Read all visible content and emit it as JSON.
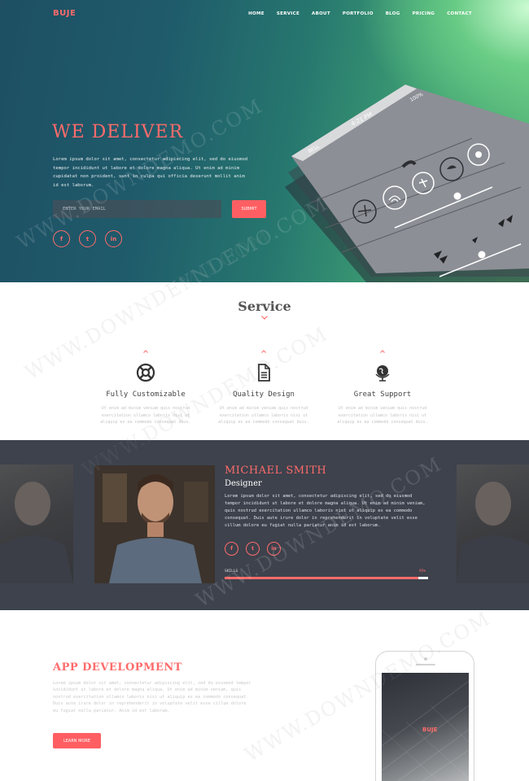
{
  "brand": {
    "logo": "BUJE",
    "accent": "#ff6b6b"
  },
  "nav": {
    "items": [
      "HOME",
      "SERVICE",
      "ABOUT",
      "PORTFOLIO",
      "BLOG",
      "PRICING",
      "CONTACT"
    ]
  },
  "hero": {
    "title": "WE DELIVER",
    "text": "Lorem ipsum dolor sit amet, consectetur adipiscing elit, sed do eiusmod tempor incididunt ut labore et dolore magna aliqua. Ut enim ad minim cupidatat non proident, sunt in culpa qui officia deserunt mollit anim id est laborum.",
    "email_placeholder": "ENTER YOUR EMAIL",
    "submit_label": "SUBMIT",
    "social": [
      "f",
      "t",
      "in"
    ],
    "phone_status": "BELL",
    "phone_time": "4:21 PM",
    "phone_battery": "100%"
  },
  "service": {
    "title": "Service",
    "items": [
      {
        "icon": "lifebuoy-icon",
        "name": "Fully Customizable",
        "desc": "Ut enim ad minim veniam quis nostrud exercitation ullamco laboris nisi ut aliquip ex ea commodo consequat duis."
      },
      {
        "icon": "document-icon",
        "name": "Quality Design",
        "desc": "Ut enim ad minim veniam quis nostrud exercitation ullamco laboris nisi ut aliquip ex ea commodo consequat duis."
      },
      {
        "icon": "globe-icon",
        "name": "Great Support",
        "desc": "Ut enim ad minim veniam quis nostrud exercitation ullamco laboris nisi ut aliquip ex ea commodo consequat duis."
      }
    ]
  },
  "profile": {
    "name": "MICHAEL SMITH",
    "role": "Designer",
    "bio": "Lorem ipsum dolor sit amet, consectetur adipiscing elit, sed do eiusmod tempor incididunt ut labore et dolore magna aliqua. Ut enim ad minim veniam, quis nostrud exercitation ullamco laboris nisi ut aliquip ex ea commodo consequat. Duis aute irure dolor in reprehenderit in voluptate velit esse cillum dolore eu fugiat nulla pariatur anim id est laborum.",
    "social": [
      "f",
      "t",
      "in"
    ],
    "skills_label": "SKILLS",
    "skills_value": "95%",
    "skills_fraction": 0.95
  },
  "app": {
    "title": "APP DEVELOPMENT",
    "text": "Lorem ipsum dolor sit amet, consectetur adipiscing elit, sed do eiusmod tempor incididunt ut labore et dolore magna aliqua. Ut enim ad minim veniam, quis nostrud exercitation ullamco laboris nisi ut aliquip ex ea commodo consequat. Duis aute irure dolor in reprehenderit in voluptate velit esse cillum dolore eu fugiat nulla pariatur. Anim id est laborum.",
    "button_label": "LEARN MORE",
    "phone_logo": "BUJE"
  },
  "watermark": "WWW.DOWNDEMO.COM"
}
